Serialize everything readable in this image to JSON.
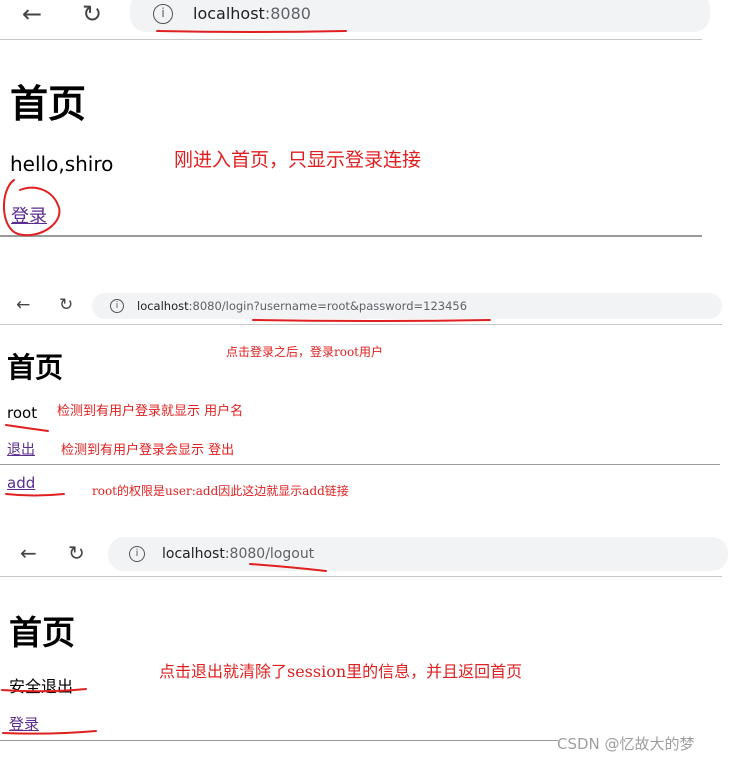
{
  "icons": {
    "back": "arrow-left",
    "reload": "reload",
    "info": "info-circle"
  },
  "panel1": {
    "url_host": "localhost",
    "url_rest": ":8080",
    "heading": "首页",
    "greeting": "hello,shiro",
    "login_link": "登录",
    "note": "刚进入首页，只显示登录连接"
  },
  "panel2": {
    "url_host": "localhost",
    "url_rest": ":8080/login?username=root&password=123456",
    "heading": "首页",
    "username": "root",
    "logout_link": "退出",
    "add_link": "add",
    "note_top": "点击登录之后，登录root用户",
    "note_user": "检测到有用户登录就显示 用户名",
    "note_logout": "检测到有用户登录会显示 登出",
    "note_add": "root的权限是user:add因此这边就显示add链接"
  },
  "panel3": {
    "url_host": "localhost",
    "url_rest": ":8080/logout",
    "heading": "首页",
    "status": "安全退出",
    "login_link": "登录",
    "note": "点击退出就清除了session里的信息，并且返回首页"
  },
  "watermark": "CSDN @忆故大的梦"
}
